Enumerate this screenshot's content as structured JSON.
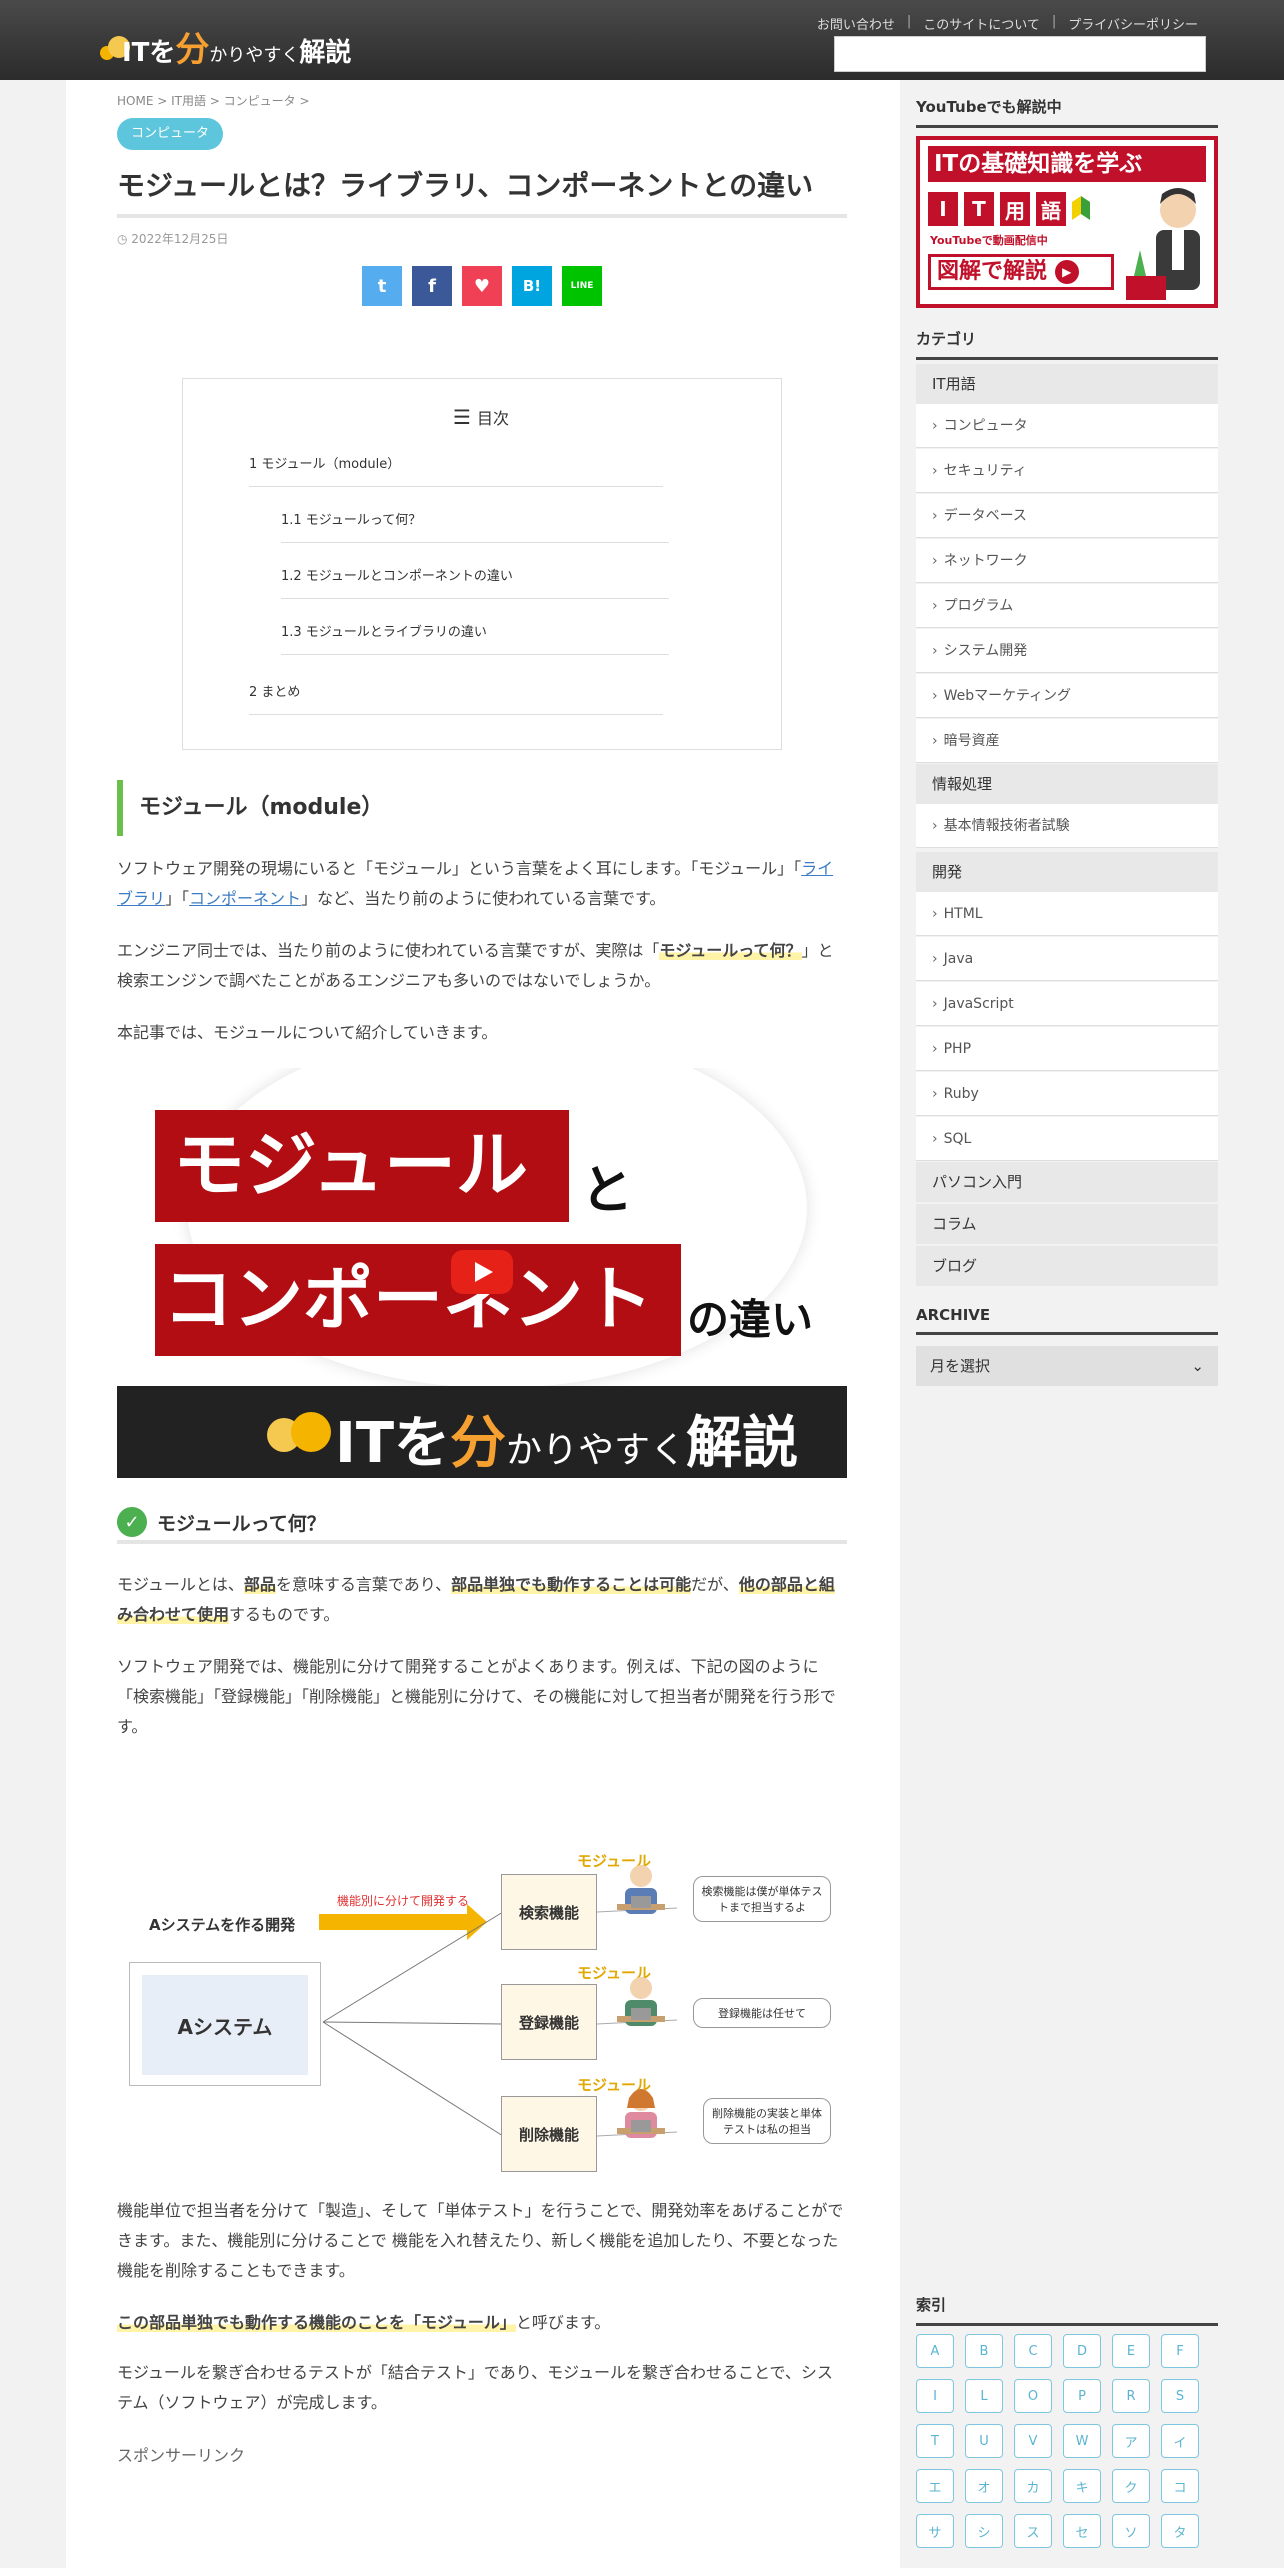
{
  "header": {
    "logo_it": "ITを",
    "logo_bun": "分",
    "logo_rest": "かりやすく",
    "logo_kaisetsu": "解説",
    "links": [
      "お問い合わせ",
      "このサイトについて",
      "プライバシーポリシー"
    ],
    "separator": "|"
  },
  "article": {
    "breadcrumb": "HOME > IT用語 > コンピュータ >",
    "category_badge": "コンピュータ",
    "title": "モジュールとは？ライブラリ、コンポーネントとの違い",
    "date": "2022年12月25日",
    "date_icon": "clock-icon",
    "share_buttons": [
      {
        "icon": "twitter-icon",
        "glyph": "t",
        "color": "#55acee"
      },
      {
        "icon": "facebook-icon",
        "glyph": "f",
        "color": "#3b5998"
      },
      {
        "icon": "pocket-icon",
        "glyph": "♥",
        "color": "#ef4056"
      },
      {
        "icon": "hatena-icon",
        "glyph": "B!",
        "color": "#00a4de"
      },
      {
        "icon": "line-icon",
        "glyph": "LINE",
        "color": "#00c300"
      }
    ],
    "toc": {
      "title": "目次",
      "items": [
        "1 モジュール（module）",
        "1.1 モジュールって何？",
        "1.2 モジュールとコンポーネントの違い",
        "1.3 モジュールとライブラリの違い",
        "2 まとめ"
      ]
    },
    "h2": "モジュール（module）",
    "p1_a": "ソフトウェア開発の現場にいると「モジュール」という言葉をよく耳にします。「モジュール」「",
    "p1_link1": "ライブラリ",
    "p1_b": "」「",
    "p1_link2": "コンポーネント",
    "p1_c": "」など、当たり前のように使われている言葉です。",
    "p2_a": "エンジニア同士では、当たり前のように使われている言葉ですが、実際は「",
    "p2_bold": "モジュールって何？",
    "p2_b": "」と検索エンジンで調べたことがあるエンジニアも多いのではないでしょうか。",
    "p3": "本記事では、モジュールについて紹介していきます。",
    "video": {
      "line1": "モジュール",
      "to": "と",
      "line2": "コンポーネント",
      "no_chigai": "の違い",
      "bar_it": "ITを",
      "bar_bun": "分",
      "bar_rest": "かりやすく",
      "bar_kaisetsu": "解説"
    },
    "h3": "モジュールって何？",
    "p4_a": "モジュールとは、",
    "p4_b1": "部品",
    "p4_c": "を意味する言葉であり、",
    "p4_b2": "部品単独でも動作することは可能",
    "p4_d": "だが、",
    "p4_b3": "他の部品と組み合わせて使用",
    "p4_e": "するものです。",
    "p5": "ソフトウェア開発では、機能別に分けて開発することがよくあります。例えば、下記の図のように「検索機能」「登録機能」「削除機能」と機能別に分けて、その機能に対して担当者が開発を行う形です。",
    "diagram": {
      "system_label": "Aシステムを作る開発",
      "arrow_label": "機能別に分けて開発する",
      "system_box": "Aシステム",
      "module_label": "モジュール",
      "functions": [
        "検索機能",
        "登録機能",
        "削除機能"
      ],
      "bubbles": [
        "検索機能は僕が単体テストまで担当するよ",
        "登録機能は任せて",
        "削除機能の実装と単体テストは私の担当"
      ]
    },
    "p6": "機能単位で担当者を分けて「製造」、そして「単体テスト」を行うことで、開発効率をあげることができます。また、機能別に分けることで 機能を入れ替えたり、新しく機能を追加したり、不要となった機能を削除することもできます。",
    "p7_bold": "この部品単独でも動作する機能のことを「モジュール」",
    "p7_rest": "と呼びます。",
    "p8": "モジュールを繋ぎ合わせるテストが「結合テスト」であり、モジュールを繋ぎ合わせることで、システム（ソフトウェア）が完成します。",
    "sponsor": "スポンサーリンク"
  },
  "sidebar": {
    "youtube_heading": "YouTubeでも解説中",
    "banner": {
      "line1": "ITの基礎知識を学ぶ",
      "chars": [
        "I",
        "T",
        "用",
        "語"
      ],
      "sub": "YouTubeで動画配信中",
      "cta": "図解で解説"
    },
    "category_heading": "カテゴリ",
    "categories": [
      {
        "label": "IT用語",
        "type": "head"
      },
      {
        "label": "コンピュータ",
        "type": "sub"
      },
      {
        "label": "セキュリティ",
        "type": "sub"
      },
      {
        "label": "データベース",
        "type": "sub"
      },
      {
        "label": "ネットワーク",
        "type": "sub"
      },
      {
        "label": "プログラム",
        "type": "sub"
      },
      {
        "label": "システム開発",
        "type": "sub"
      },
      {
        "label": "Webマーケティング",
        "type": "sub"
      },
      {
        "label": "暗号資産",
        "type": "sub"
      },
      {
        "label": "情報処理",
        "type": "head"
      },
      {
        "label": "基本情報技術者試験",
        "type": "sub"
      },
      {
        "label": "開発",
        "type": "head"
      },
      {
        "label": "HTML",
        "type": "sub"
      },
      {
        "label": "Java",
        "type": "sub"
      },
      {
        "label": "JavaScript",
        "type": "sub"
      },
      {
        "label": "PHP",
        "type": "sub"
      },
      {
        "label": "Ruby",
        "type": "sub"
      },
      {
        "label": "SQL",
        "type": "sub"
      },
      {
        "label": "パソコン入門",
        "type": "head"
      },
      {
        "label": "コラム",
        "type": "head"
      },
      {
        "label": "ブログ",
        "type": "head"
      }
    ],
    "archive_heading": "ARCHIVE",
    "archive_select": "月を選択",
    "index_heading": "索引",
    "index_letters": [
      "A",
      "B",
      "C",
      "D",
      "E",
      "F",
      "I",
      "L",
      "O",
      "P",
      "R",
      "S",
      "T",
      "U",
      "V",
      "W",
      "ア",
      "イ",
      "エ",
      "オ",
      "カ",
      "キ",
      "ク",
      "コ",
      "サ",
      "シ",
      "ス",
      "セ",
      "ソ",
      "タ"
    ]
  }
}
